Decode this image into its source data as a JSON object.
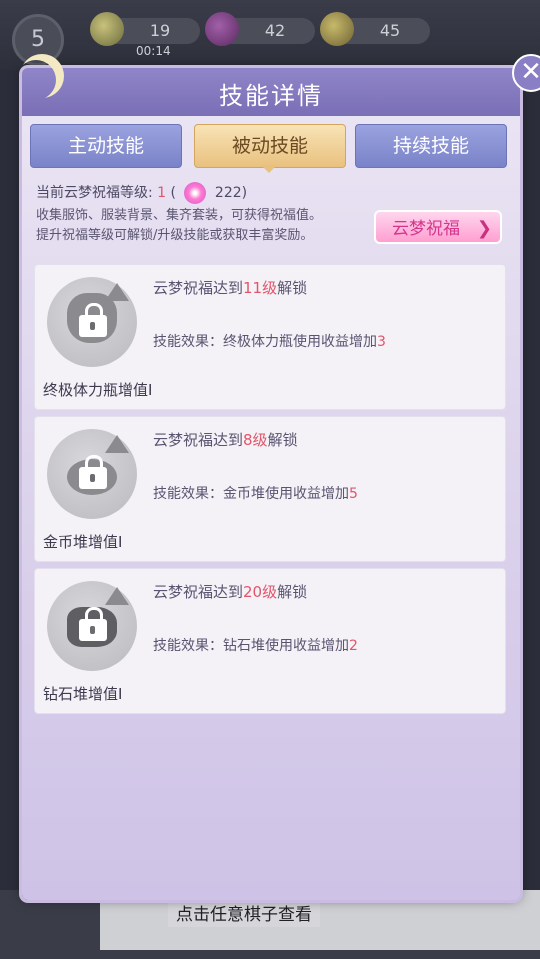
{
  "hud": {
    "level": "5",
    "energy": "19",
    "timer": "00:14",
    "gems": "42",
    "coins": "45"
  },
  "background": {
    "hint_text": "点击任意棋子查看"
  },
  "modal": {
    "title": "技能详情",
    "tabs": [
      {
        "label": "主动技能",
        "active": false
      },
      {
        "label": "被动技能",
        "active": true
      },
      {
        "label": "持续技能",
        "active": false
      }
    ],
    "blessing": {
      "level_label": "当前云梦祝福等级:",
      "level_value": "1",
      "open_paren": "(",
      "points": "222)",
      "desc_line1": "收集服饰、服装背景、集齐套装，可获得祝福值。",
      "desc_line2": "提升祝福等级可解锁/升级技能或获取丰富奖励。",
      "button_label": "云梦祝福"
    },
    "skills": [
      {
        "name": "终极体力瓶增值I",
        "unlock_prefix": "云梦祝福达到",
        "unlock_level": "11级",
        "unlock_suffix": "解锁",
        "effect_prefix": "技能效果：终极体力瓶使用收益增加",
        "effect_value": "3"
      },
      {
        "name": "金币堆增值I",
        "unlock_prefix": "云梦祝福达到",
        "unlock_level": "8级",
        "unlock_suffix": "解锁",
        "effect_prefix": "技能效果：金币堆使用收益增加",
        "effect_value": "5"
      },
      {
        "name": "钻石堆增值I",
        "unlock_prefix": "云梦祝福达到",
        "unlock_level": "20级",
        "unlock_suffix": "解锁",
        "effect_prefix": "技能效果：钻石堆使用收益增加",
        "effect_value": "2"
      }
    ]
  },
  "colors": {
    "accent_red": "#e0566a",
    "header_purple": "#7a6fb6",
    "active_tab": "#e9c17f",
    "button_pink": "#ff9fd1"
  }
}
